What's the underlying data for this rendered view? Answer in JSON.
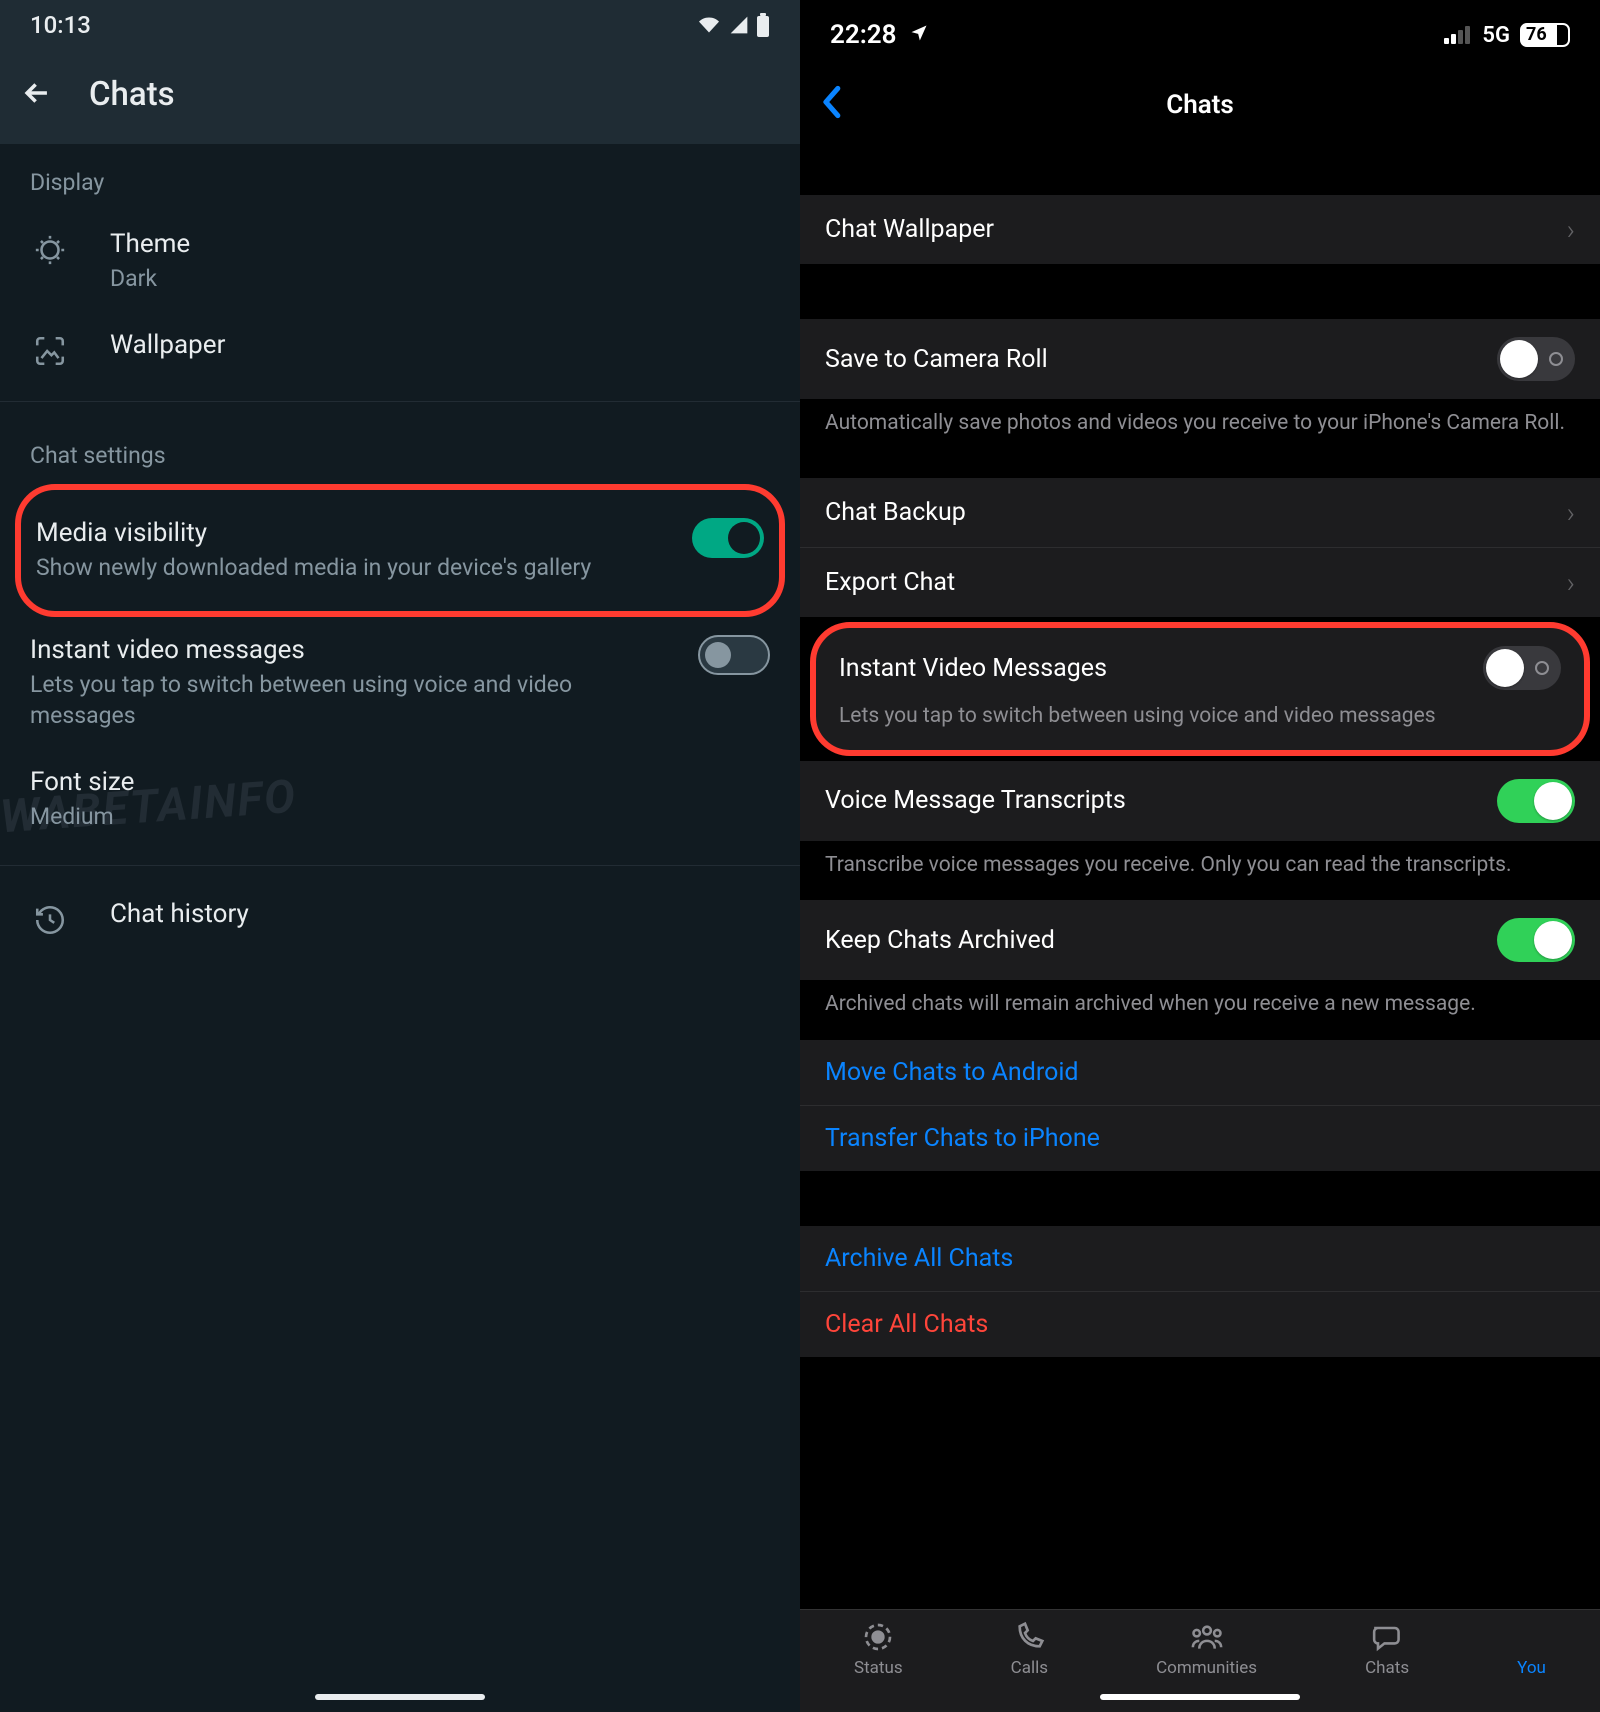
{
  "android": {
    "time": "10:13",
    "title": "Chats",
    "sections": {
      "display": "Display",
      "chat_settings": "Chat settings"
    },
    "theme": {
      "title": "Theme",
      "value": "Dark"
    },
    "wallpaper": "Wallpaper",
    "media_visibility": {
      "title": "Media visibility",
      "sub": "Show newly downloaded media in your device's gallery",
      "on": true
    },
    "instant_video": {
      "title": "Instant video messages",
      "sub": "Lets you tap to switch between using voice and video messages",
      "on": false
    },
    "font_size": {
      "title": "Font size",
      "value": "Medium"
    },
    "chat_history": "Chat history",
    "watermark": "WABETAINFO"
  },
  "ios": {
    "time": "22:28",
    "network": "5G",
    "battery": "76",
    "title": "Chats",
    "chat_wallpaper": "Chat Wallpaper",
    "save_camera": {
      "title": "Save to Camera Roll",
      "footer": "Automatically save photos and videos you receive to your iPhone's Camera Roll.",
      "on": false
    },
    "chat_backup": "Chat Backup",
    "export_chat": "Export Chat",
    "instant_video": {
      "title": "Instant Video Messages",
      "footer": "Lets you tap to switch between using voice and video messages",
      "on": false
    },
    "voice_transcripts": {
      "title": "Voice Message Transcripts",
      "footer": "Transcribe voice messages you receive. Only you can read the transcripts.",
      "on": true
    },
    "keep_archived": {
      "title": "Keep Chats Archived",
      "footer": "Archived chats will remain archived when you receive a new message.",
      "on": true
    },
    "move_android": "Move Chats to Android",
    "transfer_iphone": "Transfer Chats to iPhone",
    "archive_all": "Archive All Chats",
    "clear_all": "Clear All Chats",
    "tabs": {
      "status": "Status",
      "calls": "Calls",
      "communities": "Communities",
      "chats": "Chats",
      "you": "You"
    }
  }
}
